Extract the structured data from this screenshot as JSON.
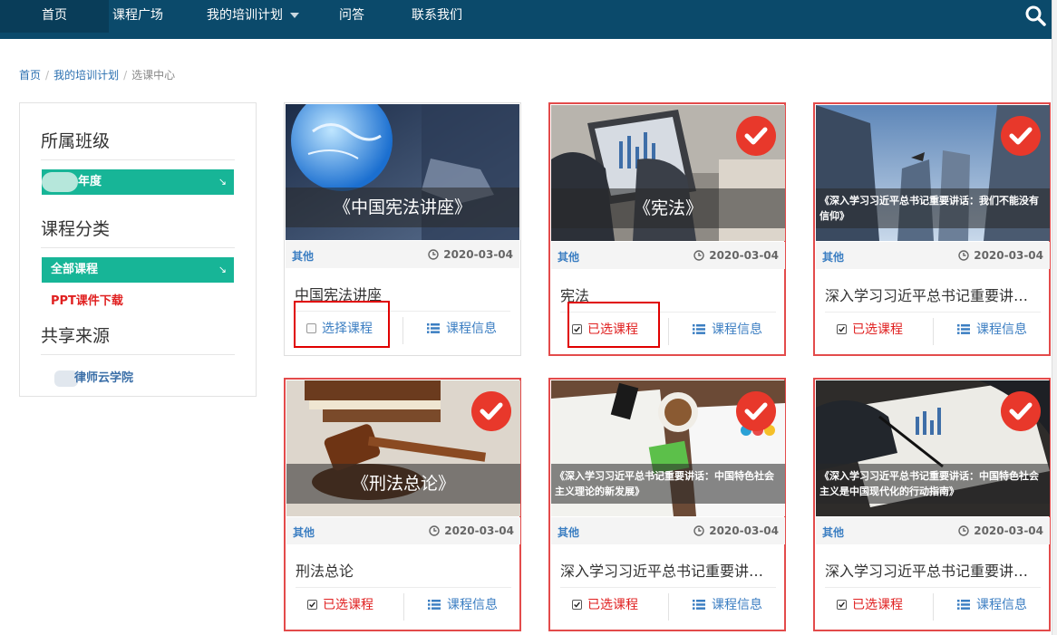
{
  "nav": {
    "items": [
      "首页",
      "课程广场",
      "我的培训计划",
      "问答",
      "联系我们"
    ],
    "active_index": 0
  },
  "breadcrumb": {
    "items": [
      "首页",
      "我的培训计划",
      "选课中心"
    ]
  },
  "sidebar": {
    "class_heading": "所属班级",
    "class_pill": "年度",
    "category_heading": "课程分类",
    "category_pill": "全部课程",
    "ppt_link": "PPT课件下载",
    "source_heading": "共享来源",
    "source_item": "律师云学院",
    "pill_arrow": "↘"
  },
  "cards": [
    {
      "caption": "《中国宪法讲座》",
      "category": "其他",
      "date": "2020-03-04",
      "title": "中国宪法讲座",
      "selected": false,
      "select_label": "选择课程",
      "info_label": "课程信息"
    },
    {
      "caption": "《宪法》",
      "category": "其他",
      "date": "2020-03-04",
      "title": "宪法",
      "selected": true,
      "select_label": "已选课程",
      "info_label": "课程信息"
    },
    {
      "caption": "《深入学习习近平总书记重要讲话：我们不能没有信仰》",
      "category": "其他",
      "date": "2020-03-04",
      "title": "深入学习习近平总书记重要讲话：我们不能没有信仰",
      "selected": true,
      "select_label": "已选课程",
      "info_label": "课程信息"
    },
    {
      "caption": "《刑法总论》",
      "category": "其他",
      "date": "2020-03-04",
      "title": "刑法总论",
      "selected": true,
      "select_label": "已选课程",
      "info_label": "课程信息"
    },
    {
      "caption": "《深入学习习近平总书记重要讲话：中国特色社会主义理论的新发展》",
      "category": "其他",
      "date": "2020-03-04",
      "title": "深入学习习近平总书记重要讲话：中国特色社会主义理论的新发展",
      "selected": true,
      "select_label": "已选课程",
      "info_label": "课程信息"
    },
    {
      "caption": "《深入学习习近平总书记重要讲话：中国特色社会主义是中国现代化的行动指南》",
      "category": "其他",
      "date": "2020-03-04",
      "title": "深入学习习近平总书记重要讲话：中国特色社会主义是中国现代化的行动指南",
      "selected": true,
      "select_label": "已选课程",
      "info_label": "课程信息"
    }
  ],
  "colors": {
    "nav_bg": "#0b4a6b",
    "accent_green": "#17b597",
    "selected_red": "#e34b4b",
    "link_blue": "#3b7ec2"
  }
}
